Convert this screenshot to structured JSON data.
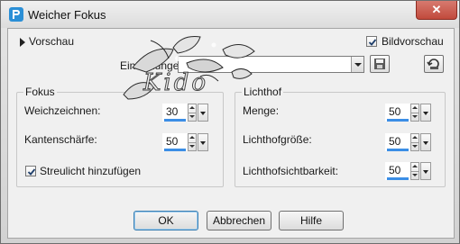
{
  "window": {
    "title": "Weicher Fokus",
    "close_label": "✕"
  },
  "preview": {
    "label": "Vorschau",
    "bild_label": "Bildvorschau",
    "bild_checked": true
  },
  "settings": {
    "label": "Einstellungen",
    "value": ""
  },
  "focus": {
    "title": "Fokus",
    "weichzeichnen_label": "Weichzeichnen:",
    "weichzeichnen_value": "30",
    "kantenschaerfe_label": "Kantenschärfe:",
    "kantenschaerfe_value": "50",
    "streulicht_label": "Streulicht hinzufügen",
    "streulicht_checked": true
  },
  "halo": {
    "title": "Lichthof",
    "menge_label": "Menge:",
    "menge_value": "50",
    "groesse_label": "Lichthofgröße:",
    "groesse_value": "50",
    "sichtbarkeit_label": "Lichthofsichtbarkeit:",
    "sichtbarkeit_value": "50"
  },
  "buttons": {
    "ok": "OK",
    "cancel": "Abbrechen",
    "help": "Hilfe"
  },
  "watermark": {
    "text": "Kido"
  }
}
